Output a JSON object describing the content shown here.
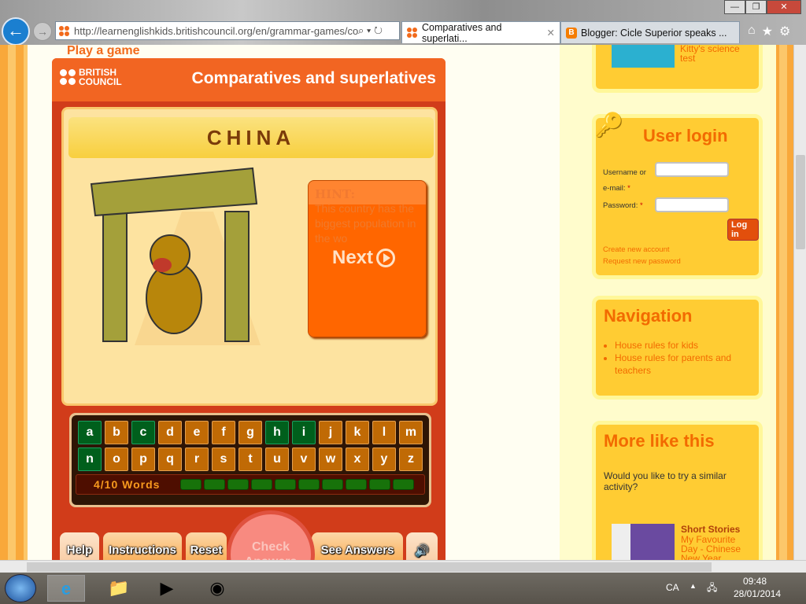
{
  "browser": {
    "url": "http://learnenglishkids.britishcouncil.org/en/grammar-games/com",
    "tabs": [
      {
        "label": "Comparatives and superlati...",
        "active": true
      },
      {
        "label": "Blogger: Cicle Superior speaks ...",
        "active": false
      }
    ],
    "window_controls": [
      "—",
      "❐",
      "✕"
    ]
  },
  "page": {
    "section_heading": "Play a game",
    "game": {
      "brand_line1": "BRITISH",
      "brand_line2": "COUNCIL",
      "title": "Comparatives and superlatives",
      "country": "CHINA",
      "hint_title": "HINT:",
      "hint_text": "This country has the biggest population in the wo",
      "next_label": "Next",
      "keyboard_rows": [
        [
          "a",
          "b",
          "c",
          "d",
          "e",
          "f",
          "g",
          "h",
          "i",
          "j",
          "k",
          "l",
          "m"
        ],
        [
          "n",
          "o",
          "p",
          "q",
          "r",
          "s",
          "t",
          "u",
          "v",
          "w",
          "x",
          "y",
          "z"
        ]
      ],
      "used_letters": [
        "a",
        "c",
        "h",
        "i",
        "n"
      ],
      "progress_label": "4/10 Words",
      "progress_segments": 10,
      "buttons": {
        "help": "Help",
        "instructions": "Instructions",
        "reset": "Reset",
        "check": "Check Answers",
        "see_answers": "See Answers"
      }
    },
    "sidebar": {
      "video_caption": "Kitty's science test",
      "login": {
        "title": "User login",
        "username_label": "Username or e-mail:",
        "password_label": "Password:",
        "required_mark": "*",
        "login_button": "Log in",
        "create_account": "Create new account",
        "request_password": "Request new password"
      },
      "navigation": {
        "title": "Navigation",
        "items": [
          "House rules for kids",
          "House rules for parents and teachers"
        ]
      },
      "more": {
        "title": "More like this",
        "text": "Would you like to try a similar activity?",
        "item_category": "Short Stories",
        "item_title": "My Favourite Day - Chinese New Year"
      }
    }
  },
  "taskbar": {
    "language": "CA",
    "time": "09:48",
    "date": "28/01/2014"
  },
  "colors": {
    "brand_orange": "#f26522",
    "used_key": "#005f1c",
    "key": "#c06a05",
    "sidebar_box": "#ffcc33"
  }
}
